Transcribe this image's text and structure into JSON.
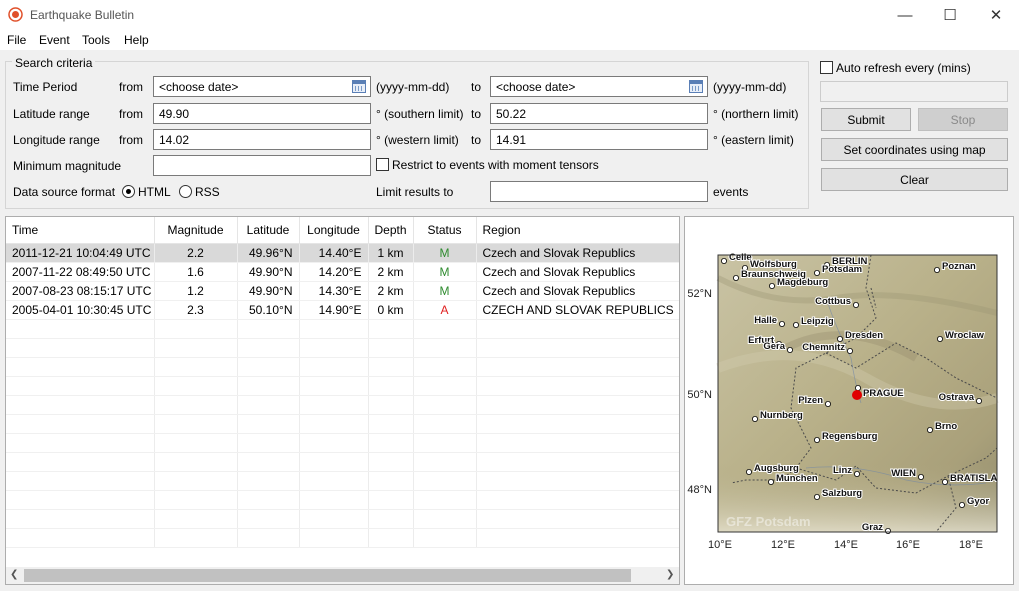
{
  "window": {
    "title": "Earthquake Bulletin",
    "minimize": "—",
    "maximize": "☐",
    "close": "✕"
  },
  "menu": [
    "File",
    "Event",
    "Tools",
    "Help"
  ],
  "criteria": {
    "legend": "Search criteria",
    "time_period_label": "Time Period",
    "from_label": "from",
    "to_label": "to",
    "date_from": "<choose date>",
    "date_to": "<choose date>",
    "date_format": "(yyyy-mm-dd)",
    "lat_label": "Latitude range",
    "lat_from": "49.90",
    "lat_to": "50.22",
    "lat_south_note": "° (southern limit)",
    "lat_north_note": "° (northern limit)",
    "lon_label": "Longitude range",
    "lon_from": "14.02",
    "lon_to": "14.91",
    "lon_west_note": "° (western limit)",
    "lon_east_note": "° (eastern limit)",
    "min_mag_label": "Minimum magnitude",
    "min_mag_value": "",
    "moment_tensor_label": "Restrict to events with moment tensors",
    "moment_tensor_checked": false,
    "format_label": "Data source format",
    "format_html": "HTML",
    "format_rss": "RSS",
    "format_selected": "HTML",
    "limit_label": "Limit results to",
    "limit_value": "",
    "events_label": "events"
  },
  "side": {
    "auto_refresh_label": "Auto refresh every (mins)",
    "auto_refresh_checked": false,
    "submit": "Submit",
    "stop": "Stop",
    "set_coords": "Set coordinates using map",
    "clear": "Clear"
  },
  "table": {
    "columns": [
      "Time",
      "Magnitude",
      "Latitude",
      "Longitude",
      "Depth",
      "Status",
      "Region"
    ],
    "rows": [
      [
        "2011-12-21 10:04:49 UTC",
        "2.2",
        "49.96°N",
        "14.40°E",
        "1 km",
        "M",
        "Czech and Slovak Republics"
      ],
      [
        "2007-11-22 08:49:50 UTC",
        "1.6",
        "49.90°N",
        "14.20°E",
        "2 km",
        "M",
        "Czech and Slovak Republics"
      ],
      [
        "2007-08-23 08:15:17 UTC",
        "1.2",
        "49.90°N",
        "14.30°E",
        "2 km",
        "M",
        "Czech and Slovak Republics"
      ],
      [
        "2005-04-01 10:30:45 UTC",
        "2.3",
        "50.10°N",
        "14.90°E",
        "0 km",
        "A",
        "CZECH AND SLOVAK REPUBLICS"
      ]
    ],
    "selected_row": 0,
    "status_colors": {
      "M": "#2e8b2e",
      "A": "#e02020"
    }
  },
  "map": {
    "lat_labels": [
      "52°N",
      "50°N",
      "48°N"
    ],
    "lon_labels": [
      "10°E",
      "12°E",
      "14°E",
      "16°E",
      "18°E"
    ],
    "cities": [
      "Celle",
      "Wolfsburg",
      "Braunschweig",
      "BERLIN",
      "Potsdam",
      "Poznan",
      "Magdeburg",
      "Cottbus",
      "Halle",
      "Leipzig",
      "Wroclaw",
      "Erfurt",
      "Gera",
      "Dresden",
      "Chemnitz",
      "PRAGUE",
      "Plzen",
      "Ostrava",
      "Nurnberg",
      "Brno",
      "Regensburg",
      "Augsburg",
      "Munchen",
      "Linz",
      "WIEN",
      "BRATISLA",
      "Salzburg",
      "Gyor",
      "Graz"
    ],
    "watermark": "GFZ Potsdam",
    "epicenter_color": "#e00000"
  }
}
